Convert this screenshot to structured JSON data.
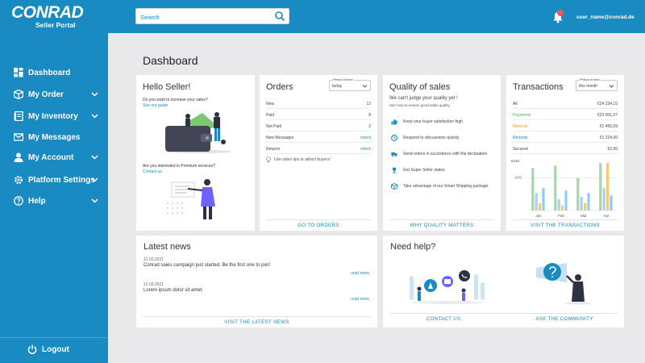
{
  "header": {
    "logo_text": "CONRAD",
    "logo_subtitle": "Seller Portal",
    "search_placeholder": "Search",
    "user_email": "user_name@conrad.de",
    "colors": {
      "brand_blue": "#1a8ac3",
      "notification_red": "#e55b5b"
    }
  },
  "sidebar": {
    "items": [
      {
        "label": "Dashboard",
        "icon": "dashboard-icon",
        "has_chevron": false
      },
      {
        "label": "My Order",
        "icon": "box-icon",
        "has_chevron": true
      },
      {
        "label": "My Inventory",
        "icon": "inventory-icon",
        "has_chevron": true
      },
      {
        "label": "My Messages",
        "icon": "envelope-icon",
        "has_chevron": false
      },
      {
        "label": "My Account",
        "icon": "user-icon",
        "has_chevron": true
      },
      {
        "label": "Platform Settings",
        "icon": "gear-icon",
        "has_chevron": true
      },
      {
        "label": "Help",
        "icon": "question-icon",
        "has_chevron": true
      }
    ],
    "logout_label": "Logout"
  },
  "main": {
    "title": "Dashboard",
    "hello": {
      "title": "Hello Seller!",
      "question1": "Do you want to increase your sales?",
      "link1": "See our guide",
      "question2": "Are you interested in Premium services?",
      "link2": "Contact us"
    },
    "orders": {
      "title": "Orders",
      "period_caption": "Period of time",
      "period_value": "today",
      "rows": [
        {
          "label": "New",
          "value": "12"
        },
        {
          "label": "Paid",
          "value": "8"
        },
        {
          "label": "Not Paid",
          "value": "2"
        },
        {
          "label": "New Messages",
          "value": "check"
        },
        {
          "label": "Returns",
          "value": "check"
        }
      ],
      "tip": "Use sales tips to attract buyers!",
      "footer": "GO TO ORDERS"
    },
    "quality": {
      "title": "Quality of sales",
      "subtitle": "We can't judge your quality yet !",
      "how_to": "See how to ensure good sales quality",
      "items": [
        {
          "text": "Keep your buyer satisfaction high",
          "icon": "thumbs-up-icon"
        },
        {
          "text": "Respond to discussions quickly",
          "icon": "clock-icon"
        },
        {
          "text": "Send orders in accordance with the declaration",
          "icon": "truck-icon"
        },
        {
          "text": "Get Super Seller status",
          "icon": "trophy-icon"
        },
        {
          "text": "Take advantage of our Smart Shipping package",
          "icon": "package-icon"
        }
      ],
      "footer": "WHY QUALITY MATTERS"
    },
    "transactions": {
      "title": "Transactions",
      "period_caption": "Period of time",
      "period_value": "this month",
      "rows": [
        {
          "label": "All",
          "value": "€24 234,15",
          "color": "#444444"
        },
        {
          "label": "Payments",
          "value": "€23 001,07",
          "color": "#4caf50"
        },
        {
          "label": "Refunds",
          "value": "€1 455,09",
          "color": "#f0a020"
        },
        {
          "label": "Refunds",
          "value": "€1 224,00",
          "color": "#1a8ac3"
        },
        {
          "label": "Secured",
          "value": "€2,00",
          "color": "#444444"
        }
      ],
      "chart_data": {
        "type": "bar",
        "categories": [
          "Jan",
          "Feb",
          "Mar",
          "Apr"
        ],
        "y_tick_label": "€24K",
        "avg_label": "AVG",
        "series": [
          {
            "values": [
              34,
              36,
              26,
              38
            ],
            "color": "#a5d6a7"
          },
          {
            "values": [
              14,
              9,
              11,
              18
            ],
            "color": "#a9d1ee"
          },
          {
            "values": [
              6,
              4,
              6,
              38
            ],
            "color": "#f7c873"
          },
          {
            "values": [
              18,
              16,
              14,
              12
            ],
            "color": "#90caf9"
          }
        ],
        "ylim": [
          0,
          40
        ]
      },
      "footer": "VISIT THE TRANSACTIONS"
    },
    "news": {
      "title": "Latest news",
      "items": [
        {
          "date": "12.03.2021",
          "text": "Conrad saies campaign just started. Be the first one to join!",
          "more": "read more"
        },
        {
          "date": "12.03.2021",
          "text": "Lorem ipsum dolor sit amet.",
          "more": "read more"
        }
      ],
      "footer": "VISIT THE LATEST NEWS"
    },
    "help": {
      "title": "Need help?",
      "contact": "CONTACT US",
      "community": "ASK THE COMMUNITY"
    }
  }
}
